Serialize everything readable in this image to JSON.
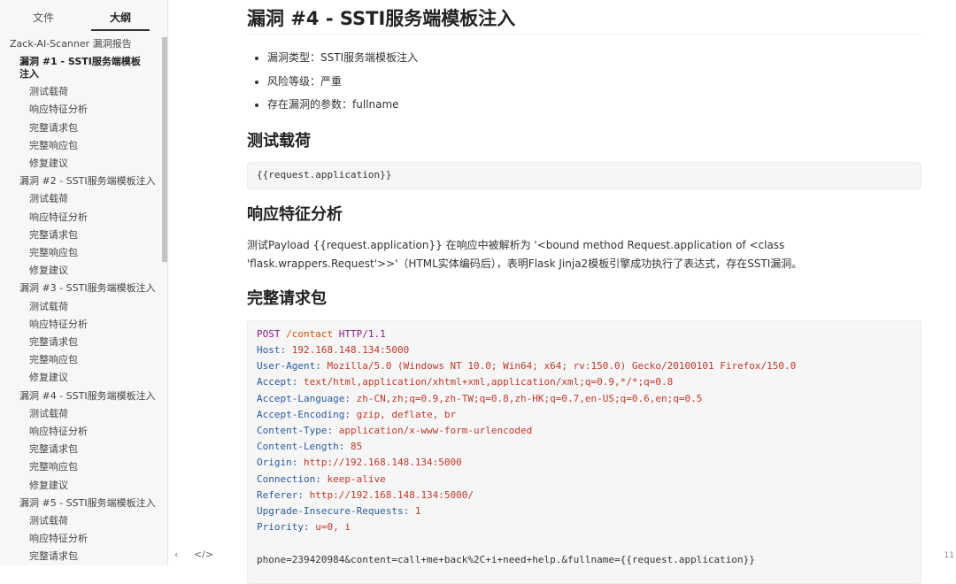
{
  "sidebar": {
    "tabs": [
      "文件",
      "大纲"
    ],
    "outline": [
      {
        "label": "Zack-AI-Scanner 漏洞报告",
        "level": 1
      },
      {
        "label": "漏洞 #1 - SSTI服务端模板注入",
        "level": 2,
        "bold": true
      },
      {
        "label": "测试载荷",
        "level": 3
      },
      {
        "label": "响应特征分析",
        "level": 3
      },
      {
        "label": "完整请求包",
        "level": 3
      },
      {
        "label": "完整响应包",
        "level": 3
      },
      {
        "label": "修复建议",
        "level": 3
      },
      {
        "label": "漏洞 #2 - SSTI服务端模板注入",
        "level": 2
      },
      {
        "label": "测试载荷",
        "level": 3
      },
      {
        "label": "响应特征分析",
        "level": 3
      },
      {
        "label": "完整请求包",
        "level": 3
      },
      {
        "label": "完整响应包",
        "level": 3
      },
      {
        "label": "修复建议",
        "level": 3
      },
      {
        "label": "漏洞 #3 - SSTI服务端模板注入",
        "level": 2
      },
      {
        "label": "测试载荷",
        "level": 3
      },
      {
        "label": "响应特征分析",
        "level": 3
      },
      {
        "label": "完整请求包",
        "level": 3
      },
      {
        "label": "完整响应包",
        "level": 3
      },
      {
        "label": "修复建议",
        "level": 3
      },
      {
        "label": "漏洞 #4 - SSTI服务端模板注入",
        "level": 2
      },
      {
        "label": "测试载荷",
        "level": 3
      },
      {
        "label": "响应特征分析",
        "level": 3
      },
      {
        "label": "完整请求包",
        "level": 3
      },
      {
        "label": "完整响应包",
        "level": 3
      },
      {
        "label": "修复建议",
        "level": 3
      },
      {
        "label": "漏洞 #5 - SSTI服务端模板注入",
        "level": 2
      },
      {
        "label": "测试载荷",
        "level": 3
      },
      {
        "label": "响应特征分析",
        "level": 3
      },
      {
        "label": "完整请求包",
        "level": 3
      }
    ],
    "bottom": {
      "back_icon": "‹",
      "source_icon": "</>"
    }
  },
  "page_num": "11",
  "main": {
    "title": "漏洞 #4 - SSTI服务端模板注入",
    "bullets": [
      "漏洞类型：SSTI服务端模板注入",
      "风险等级：严重",
      "存在漏洞的参数：fullname"
    ],
    "h_payload": "测试载荷",
    "payload": "{{request.application}}",
    "h_analysis": "响应特征分析",
    "analysis_line1": "测试Payload {{request.application}} 在响应中被解析为 '<bound method Request.application of <class",
    "analysis_line2": "'flask.wrappers.Request'>>'（HTML实体编码后），表明Flask Jinja2模板引擎成功执行了表达式，存在SSTI漏洞。",
    "h_request": "完整请求包",
    "request_line": {
      "method": "POST",
      "path": "/contact",
      "proto": "HTTP/1.1"
    },
    "headers": [
      {
        "name": "Host:",
        "value": "192.168.148.134:5000"
      },
      {
        "name": "User-Agent:",
        "value": "Mozilla/5.0 (Windows NT 10.0; Win64; x64; rv:150.0) Gecko/20100101 Firefox/150.0"
      },
      {
        "name": "Accept:",
        "value": "text/html,application/xhtml+xml,application/xml;q=0.9,*/*;q=0.8"
      },
      {
        "name": "Accept-Language:",
        "value": "zh-CN,zh;q=0.9,zh-TW;q=0.8,zh-HK;q=0.7,en-US;q=0.6,en;q=0.5"
      },
      {
        "name": "Accept-Encoding:",
        "value": "gzip, deflate, br"
      },
      {
        "name": "Content-Type:",
        "value": "application/x-www-form-urlencoded"
      },
      {
        "name": "Content-Length:",
        "value": "85"
      },
      {
        "name": "Origin:",
        "value": "http://192.168.148.134:5000"
      },
      {
        "name": "Connection:",
        "value": "keep-alive"
      },
      {
        "name": "Referer:",
        "value": "http://192.168.148.134:5000/"
      },
      {
        "name": "Upgrade-Insecure-Requests:",
        "value": "1"
      },
      {
        "name": "Priority:",
        "value": "u=0, i"
      }
    ],
    "body_line": "phone=239420984&content=call+me+back%2C+i+need+help.&fullname={{request.application}}"
  }
}
